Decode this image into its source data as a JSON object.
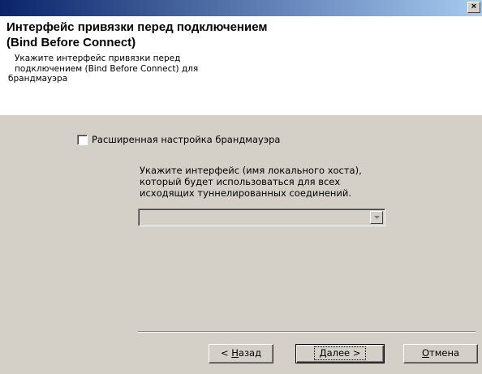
{
  "titlebar": {
    "close_label": "×"
  },
  "header": {
    "title": "Интерфейс привязки перед подключением (Bind Before Connect)",
    "subtitle": "Укажите интерфейс привязки перед подключением (Bind Before Connect) для",
    "subtitle_cont": "брандмауэра"
  },
  "advanced": {
    "checkbox_label": "Расширенная настройка брандмауэра",
    "checked": false,
    "description": "Укажите интерфейс (имя локального хоста), который будет использоваться для всех исходящих туннелированных соединений.",
    "combo_value": ""
  },
  "buttons": {
    "back_prefix": "< ",
    "back_accel": "Н",
    "back_rest": "азад",
    "next_accel": "Д",
    "next_rest": "алее >",
    "cancel_accel": "О",
    "cancel_rest": "тмена"
  }
}
